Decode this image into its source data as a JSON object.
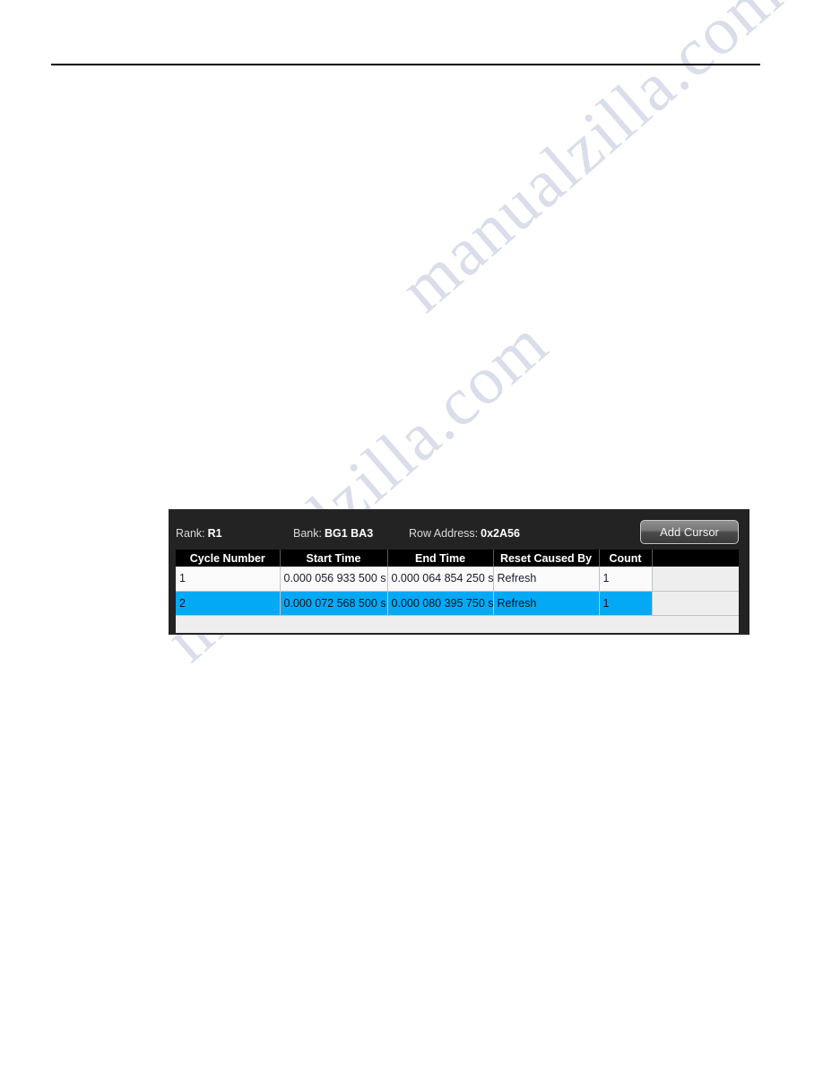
{
  "page": {
    "has_top_rule": true
  },
  "watermark": {
    "line1": "manualzilla.com",
    "line2": "manualzilla.com"
  },
  "panel": {
    "meta": {
      "rank_label": "Rank:",
      "rank_value": "R1",
      "bank_label": "Bank:",
      "bank_value": "BG1 BA3",
      "row_address_label": "Row Address:",
      "row_address_value": "0x2A56"
    },
    "add_cursor_label": "Add Cursor",
    "colors": {
      "panel_background": "#232323",
      "header_background": "#000000",
      "selection": "#03a9f5",
      "row_background": "#fbfbfb",
      "filler_background": "#eeeeee"
    },
    "table": {
      "columns": [
        "Cycle Number",
        "Start Time",
        "End Time",
        "Reset Caused By",
        "Count",
        ""
      ],
      "rows": [
        {
          "selected": false,
          "cells": [
            "1",
            "0.000 056 933 500 s",
            "0.000 064 854 250 s",
            "Refresh",
            "1",
            ""
          ]
        },
        {
          "selected": true,
          "cells": [
            "2",
            "0.000 072 568 500 s",
            "0.000 080 395 750 s",
            "Refresh",
            "1",
            ""
          ]
        }
      ]
    }
  }
}
